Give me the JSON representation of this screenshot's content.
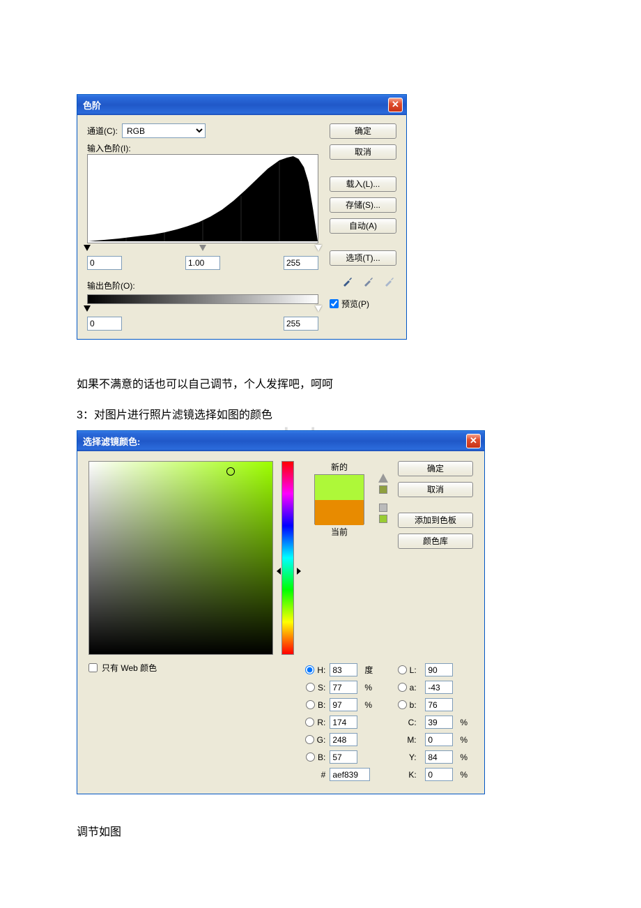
{
  "watermark": "www.bdocx.com",
  "levels": {
    "title": "色阶",
    "channel_label": "通道(C):",
    "channel_value": "RGB",
    "input_levels_label": "输入色阶(I):",
    "input_black": "0",
    "input_gamma": "1.00",
    "input_white": "255",
    "output_levels_label": "输出色阶(O):",
    "output_black": "0",
    "output_white": "255",
    "buttons": {
      "ok": "确定",
      "cancel": "取消",
      "load": "载入(L)...",
      "save": "存储(S)...",
      "auto": "自动(A)",
      "options": "选项(T)..."
    },
    "preview_label": "预览(P)",
    "preview_checked": true
  },
  "text1": "如果不满意的话也可以自己调节，个人发挥吧，呵呵",
  "text2": "3：对图片进行照片滤镜选择如图的颜色",
  "text3": "调节如图",
  "colorpicker": {
    "title": "选择滤镜颜色:",
    "new_label": "新的",
    "current_label": "当前",
    "buttons": {
      "ok": "确定",
      "cancel": "取消",
      "add": "添加到色板",
      "lib": "颜色库"
    },
    "H_label": "H:",
    "H_val": "83",
    "H_unit": "度",
    "S_label": "S:",
    "S_val": "77",
    "S_unit": "%",
    "Bv_label": "B:",
    "Bv_val": "97",
    "Bv_unit": "%",
    "R_label": "R:",
    "R_val": "174",
    "G_label": "G:",
    "G_val": "248",
    "B_label": "B:",
    "B_val": "57",
    "L_label": "L:",
    "L_val": "90",
    "a_label": "a:",
    "a_val": "-43",
    "b_label": "b:",
    "b_val": "76",
    "C_label": "C:",
    "C_val": "39",
    "pct": "%",
    "M_label": "M:",
    "M_val": "0",
    "Y_label": "Y:",
    "Y_val": "84",
    "K_label": "K:",
    "K_val": "0",
    "hex_label": "#",
    "hex_val": "aef839",
    "webonly_label": "只有 Web 颜色",
    "webonly_checked": false
  }
}
